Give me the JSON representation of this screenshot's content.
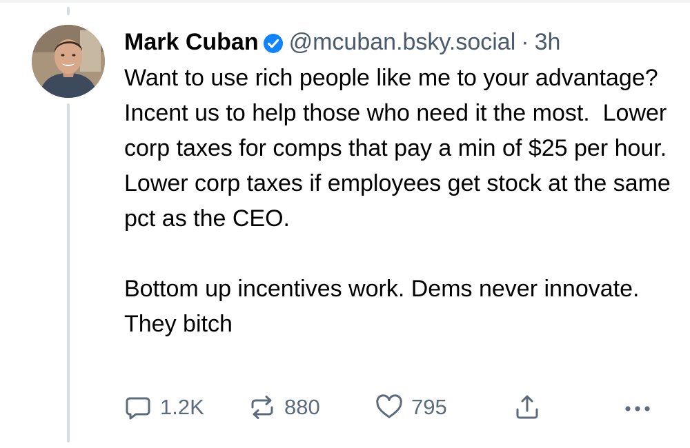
{
  "post": {
    "author": {
      "display_name": "Mark Cuban",
      "handle": "@mcuban.bsky.social",
      "verified": true
    },
    "separator": "·",
    "time": "3h",
    "text_paragraphs": [
      "Want to use rich people like me to your advantage? Incent us to help those who need it the most.  Lower corp taxes for comps that pay a min of $25 per hour. Lower corp taxes if employees get stock at the same pct as the CEO.",
      "Bottom up incentives work. Dems never innovate. They bitch"
    ],
    "actions": {
      "reply": {
        "icon": "reply-icon",
        "count": "1.2K"
      },
      "repost": {
        "icon": "repost-icon",
        "count": "880"
      },
      "like": {
        "icon": "heart-icon",
        "count": "795"
      },
      "share": {
        "icon": "share-icon"
      },
      "more": {
        "icon": "more-icon"
      }
    }
  },
  "colors": {
    "verified_badge": "#1083fe",
    "meta_text": "#4a5a6c",
    "action_icons": "#5b6b7c",
    "thread_line": "#d4dbe2"
  }
}
